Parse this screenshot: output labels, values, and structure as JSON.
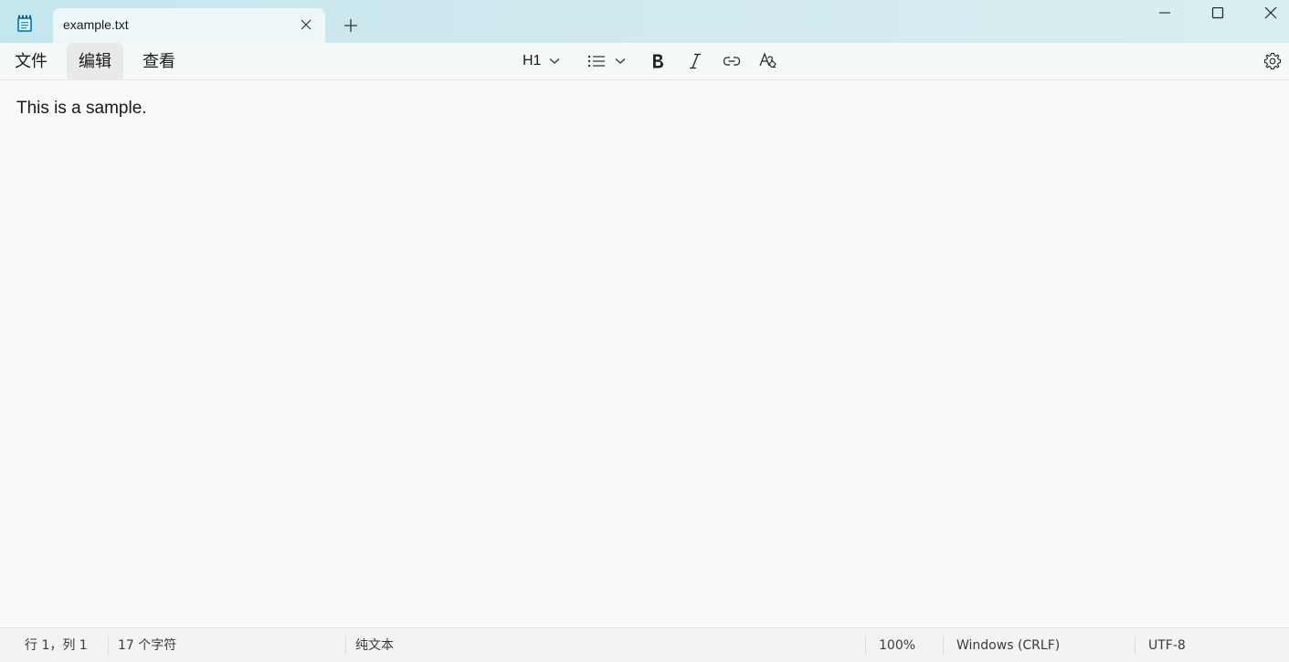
{
  "window": {
    "tab_title": "example.txt",
    "icons": {
      "app": "notepad-icon",
      "close_tab": "close-icon",
      "new_tab": "plus-icon",
      "minimize": "minimize-icon",
      "maximize": "maximize-icon",
      "close": "close-icon"
    }
  },
  "menu": {
    "items": [
      {
        "label": "文件"
      },
      {
        "label": "编辑"
      },
      {
        "label": "查看"
      }
    ]
  },
  "format_toolbar": {
    "heading_label": "H1",
    "icons": [
      "chevron-down-icon",
      "list-icon",
      "bold-icon",
      "italic-icon",
      "link-icon",
      "clear-formatting-icon",
      "settings-icon"
    ]
  },
  "editor": {
    "content": "This is a sample."
  },
  "status": {
    "position": "行 1，列 1",
    "char_count": "17 个字符",
    "format": "纯文本",
    "zoom": "100%",
    "line_ending": "Windows (CRLF)",
    "encoding": "UTF-8"
  },
  "colors": {
    "titlebar": "#c4e6ee",
    "tab_active": "#eef7f8",
    "editor_bg": "#f9f9f9",
    "statusbar_bg": "#f3f3f3"
  }
}
